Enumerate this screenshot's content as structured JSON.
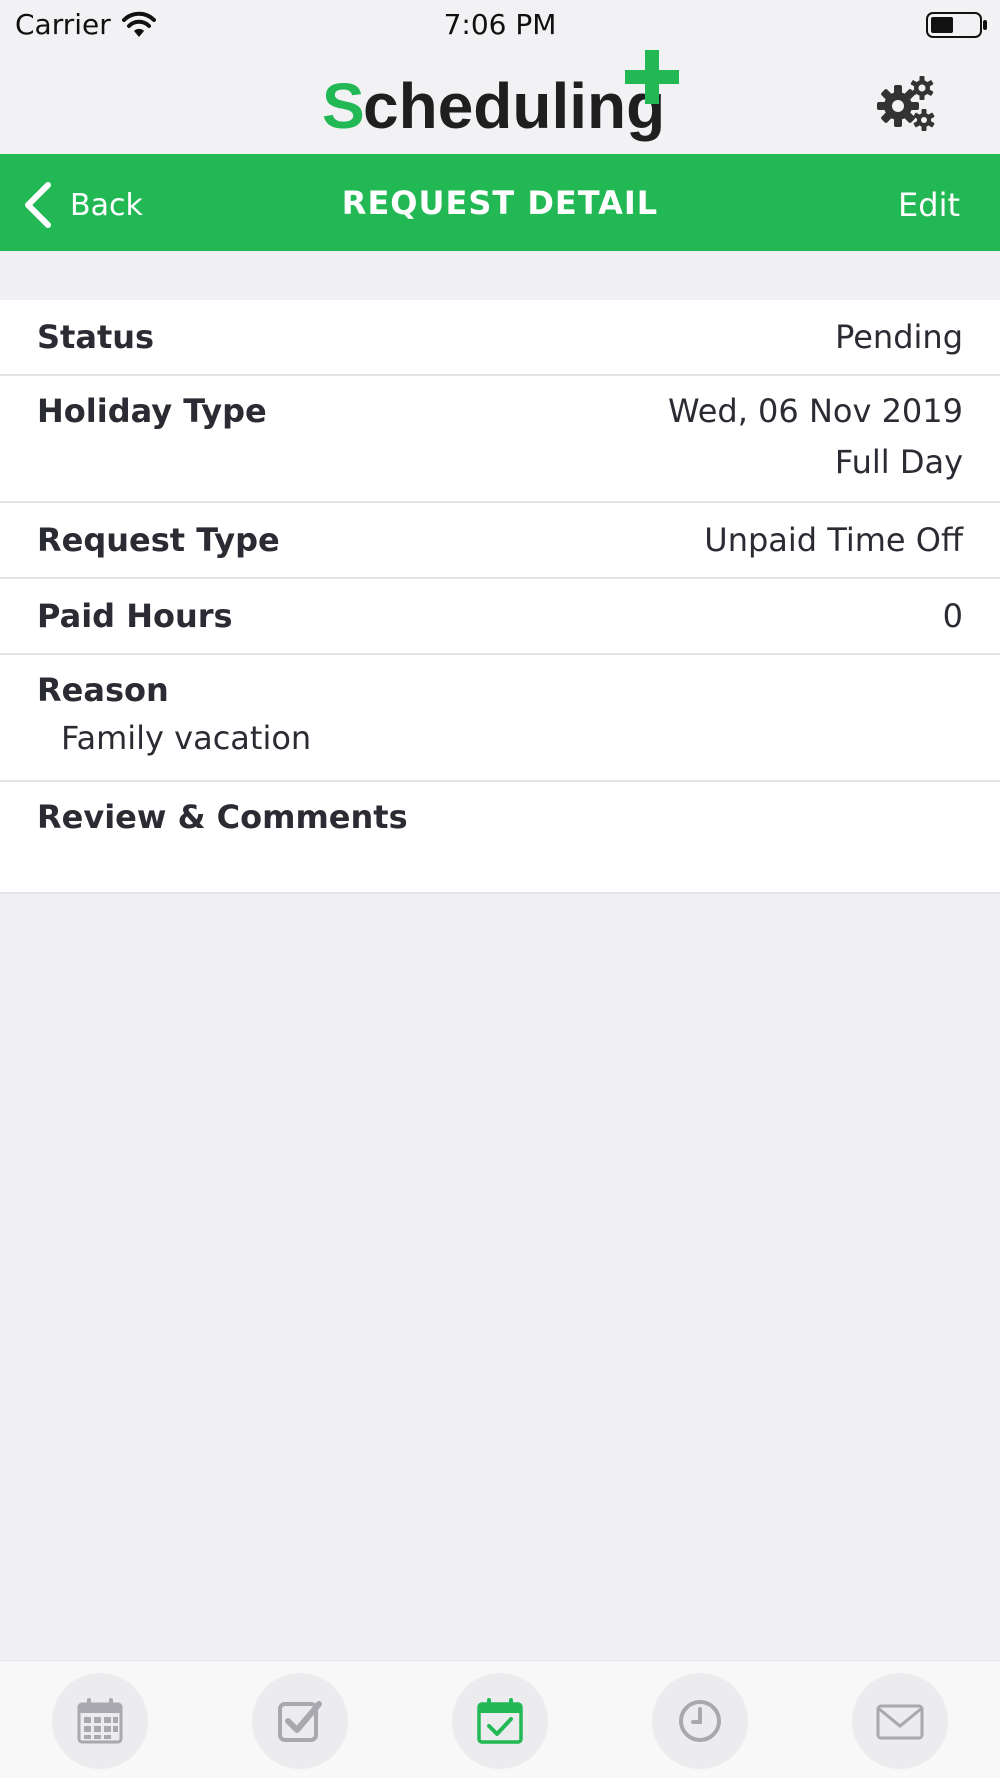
{
  "status_bar": {
    "carrier": "Carrier",
    "time": "7:06 PM"
  },
  "header": {
    "app_name": "Scheduling",
    "accent_color": "#22b955",
    "settings_icon": "gear-icon"
  },
  "nav": {
    "back_label": "Back",
    "title": "REQUEST DETAIL",
    "edit_label": "Edit"
  },
  "details": {
    "status": {
      "label": "Status",
      "value": "Pending"
    },
    "holiday_type": {
      "label": "Holiday Type",
      "date": "Wed, 06 Nov 2019",
      "duration": "Full Day"
    },
    "request_type": {
      "label": "Request Type",
      "value": "Unpaid Time Off"
    },
    "paid_hours": {
      "label": "Paid Hours",
      "value": "0"
    },
    "reason": {
      "label": "Reason",
      "value": "Family vacation"
    },
    "review": {
      "label": "Review & Comments"
    }
  },
  "tabs": [
    {
      "icon": "calendar-icon",
      "active": false
    },
    {
      "icon": "checkbox-icon",
      "active": false
    },
    {
      "icon": "calendar-check-icon",
      "active": true
    },
    {
      "icon": "clock-icon",
      "active": false
    },
    {
      "icon": "mail-icon",
      "active": false
    }
  ]
}
